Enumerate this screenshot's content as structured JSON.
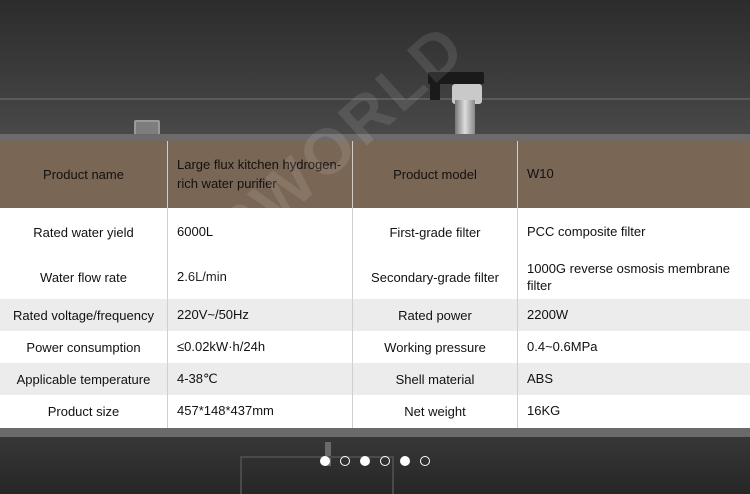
{
  "watermark": "GSWORLD",
  "specs": {
    "header": {
      "label1": "Product name",
      "value1": "Large flux kitchen hydrogen-rich water purifier",
      "label2": "Product model",
      "value2": "W10"
    },
    "rows": [
      {
        "label1": "Rated water yield",
        "value1": "6000L",
        "label2": "First-grade filter",
        "value2": "PCC composite filter"
      },
      {
        "label1": "Water flow rate",
        "value1": "2.6L/min",
        "label2": "Secondary-grade filter",
        "value2": "1000G reverse osmosis membrane filter"
      },
      {
        "label1": "Rated voltage/frequency",
        "value1": "220V~/50Hz",
        "label2": "Rated power",
        "value2": "2200W"
      },
      {
        "label1": "Power consumption",
        "value1": "≤0.02kW·h/24h",
        "label2": "Working pressure",
        "value2": "0.4~0.6MPa"
      },
      {
        "label1": "Applicable temperature",
        "value1": "4-38℃",
        "label2": "Shell material",
        "value2": "ABS"
      },
      {
        "label1": "Product size",
        "value1": "457*148*437mm",
        "label2": "Net weight",
        "value2": "16KG"
      }
    ]
  },
  "carousel": {
    "dots": [
      "filled",
      "hollow",
      "filled",
      "hollow",
      "filled",
      "hollow"
    ]
  },
  "colors": {
    "header_bg": "#7a6655",
    "row_white": "#ffffff",
    "row_grey": "#ececec"
  }
}
